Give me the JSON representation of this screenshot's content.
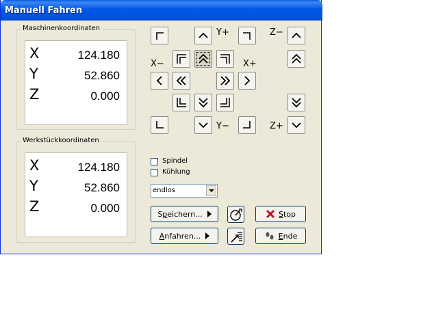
{
  "window": {
    "title": "Manuell Fahren"
  },
  "machine_coords": {
    "legend": "Maschinenkoordinaten",
    "rows": [
      {
        "axis": "X",
        "value": "124.180"
      },
      {
        "axis": "Y",
        "value": "52.860"
      },
      {
        "axis": "Z",
        "value": "0.000"
      }
    ]
  },
  "workpiece_coords": {
    "legend": "Werkstückkoordinaten",
    "rows": [
      {
        "axis": "X",
        "value": "124.180"
      },
      {
        "axis": "Y",
        "value": "52.860"
      },
      {
        "axis": "Z",
        "value": "0.000"
      }
    ]
  },
  "jog": {
    "labels": {
      "y_plus": "Y+",
      "y_minus": "Y−",
      "x_minus": "X−",
      "x_plus": "X+",
      "z_minus": "Z−",
      "z_plus": "Z+"
    }
  },
  "options": {
    "spindle_label": "Spindel",
    "coolant_label": "Kühlung",
    "mode_value": "endlos"
  },
  "buttons": {
    "save_prefix": "S",
    "save_underlined": "p",
    "save_suffix": "eichern...",
    "move_underlined": "A",
    "move_suffix": "nfahren...",
    "stop_underlined": "S",
    "stop_suffix": "top",
    "end_underlined": "E",
    "end_suffix": "nde"
  },
  "colors": {
    "titlebar": "#0058e6",
    "dialog_bg": "#ece9d8",
    "stop_icon": "#c0141b"
  }
}
